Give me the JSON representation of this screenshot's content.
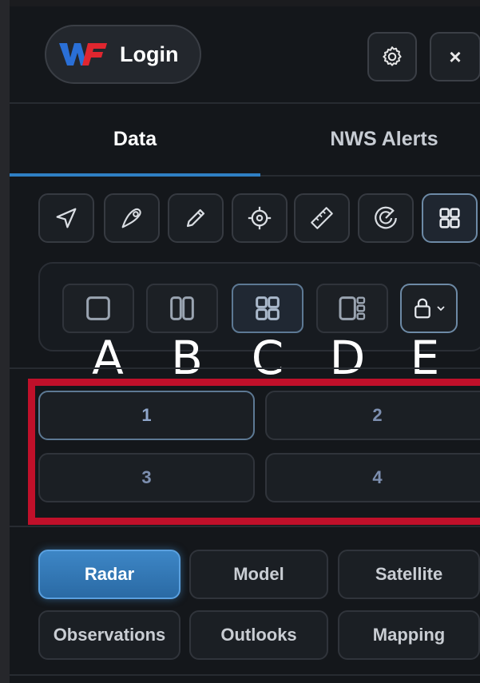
{
  "header": {
    "logo_text": "WF",
    "login_label": "Login",
    "close_label": "×"
  },
  "tabs": [
    {
      "label": "Data",
      "active": true
    },
    {
      "label": "NWS Alerts",
      "active": false
    }
  ],
  "tools": [
    {
      "icon": "navigation-arrow-icon"
    },
    {
      "icon": "location-pin-icon"
    },
    {
      "icon": "pencil-icon"
    },
    {
      "icon": "crosshair-icon"
    },
    {
      "icon": "ruler-icon"
    },
    {
      "icon": "radar-gauge-icon"
    },
    {
      "icon": "grid-layout-icon",
      "active": true
    }
  ],
  "layouts": [
    {
      "icon": "single-pane-icon"
    },
    {
      "icon": "two-pane-icon"
    },
    {
      "icon": "four-pane-icon",
      "active": true
    },
    {
      "icon": "side-panel-layout-icon"
    },
    {
      "icon": "lock-icon"
    }
  ],
  "annotations": [
    "A",
    "B",
    "C",
    "D",
    "E"
  ],
  "panes": [
    {
      "label": "1",
      "active": true
    },
    {
      "label": "2"
    },
    {
      "label": "3"
    },
    {
      "label": "4"
    }
  ],
  "sources": [
    {
      "label": "Radar",
      "active": true
    },
    {
      "label": "Model"
    },
    {
      "label": "Satellite"
    },
    {
      "label": "Observations"
    },
    {
      "label": "Outlooks"
    },
    {
      "label": "Mapping"
    }
  ],
  "colors": {
    "accent": "#2f7fc4",
    "highlight_frame": "#c0102a",
    "panel_bg": "#14171b"
  }
}
